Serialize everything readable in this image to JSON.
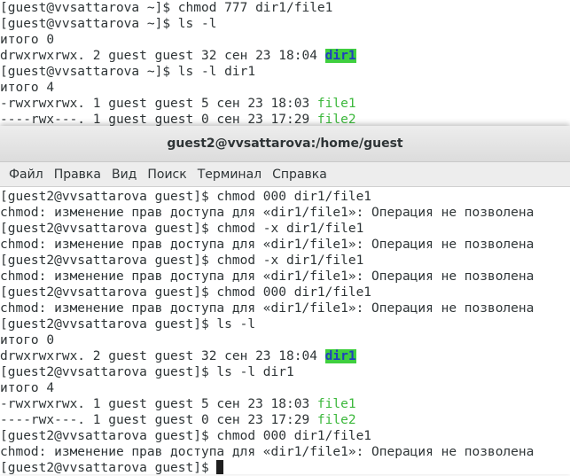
{
  "back_terminal": {
    "lines": [
      [
        {
          "t": "[guest@vvsattarova ~]$ chmod 777 dir1/file1"
        }
      ],
      [
        {
          "t": "[guest@vvsattarova ~]$ ls -l"
        }
      ],
      [
        {
          "t": "итого 0"
        }
      ],
      [
        {
          "t": "drwxrwxrwx. 2 guest guest 32 сен 23 18:04 "
        },
        {
          "t": "dir1",
          "c": "dir"
        }
      ],
      [
        {
          "t": "[guest@vvsattarova ~]$ ls -l dir1"
        }
      ],
      [
        {
          "t": "итого 4"
        }
      ],
      [
        {
          "t": "-rwxrwxrwx. 1 guest guest 5 сен 23 18:03 "
        },
        {
          "t": "file1",
          "c": "exe"
        }
      ],
      [
        {
          "t": "----rwx---. 1 guest guest 0 сен 23 17:29 "
        },
        {
          "t": "file2",
          "c": "exe"
        }
      ]
    ]
  },
  "front_window": {
    "title": "guest2@vvsattarova:/home/guest",
    "menu": [
      "Файл",
      "Правка",
      "Вид",
      "Поиск",
      "Терминал",
      "Справка"
    ]
  },
  "front_terminal": {
    "lines": [
      [
        {
          "t": "[guest2@vvsattarova guest]$ chmod 000 dir1/file1"
        }
      ],
      [
        {
          "t": "chmod: изменение прав доступа для «dir1/file1»: Операция не позволена"
        }
      ],
      [
        {
          "t": "[guest2@vvsattarova guest]$ chmod -x dir1/file1"
        }
      ],
      [
        {
          "t": "chmod: изменение прав доступа для «dir1/file1»: Операция не позволена"
        }
      ],
      [
        {
          "t": "[guest2@vvsattarova guest]$ chmod -x dir1/file1"
        }
      ],
      [
        {
          "t": "chmod: изменение прав доступа для «dir1/file1»: Операция не позволена"
        }
      ],
      [
        {
          "t": "[guest2@vvsattarova guest]$ chmod 000 dir1/file1"
        }
      ],
      [
        {
          "t": "chmod: изменение прав доступа для «dir1/file1»: Операция не позволена"
        }
      ],
      [
        {
          "t": "[guest2@vvsattarova guest]$ ls -l"
        }
      ],
      [
        {
          "t": "итого 0"
        }
      ],
      [
        {
          "t": "drwxrwxrwx. 2 guest guest 32 сен 23 18:04 "
        },
        {
          "t": "dir1",
          "c": "dir"
        }
      ],
      [
        {
          "t": "[guest2@vvsattarova guest]$ ls -l dir1"
        }
      ],
      [
        {
          "t": "итого 4"
        }
      ],
      [
        {
          "t": "-rwxrwxrwx. 1 guest guest 5 сен 23 18:03 "
        },
        {
          "t": "file1",
          "c": "exe"
        }
      ],
      [
        {
          "t": "----rwx---. 1 guest guest 0 сен 23 17:29 "
        },
        {
          "t": "file2",
          "c": "exe"
        }
      ],
      [
        {
          "t": "[guest2@vvsattarova guest]$ chmod 000 dir1/file1"
        }
      ],
      [
        {
          "t": "chmod: изменение прав доступа для «dir1/file1»: Операция не позволена"
        }
      ],
      [
        {
          "t": "[guest2@vvsattarova guest]$ "
        },
        {
          "t": "",
          "c": "cursor"
        }
      ]
    ]
  }
}
